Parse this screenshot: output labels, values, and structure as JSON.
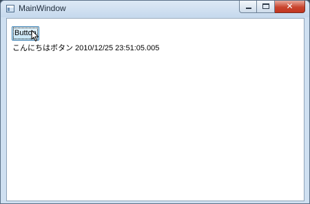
{
  "window": {
    "title": "MainWindow",
    "icon": "app-window-icon",
    "close_glyph": "✕"
  },
  "content": {
    "button_label": "Button",
    "status_text": "こんにちはボタン 2010/12/25 23:51:05.005"
  },
  "icons": {
    "cursor": "arrow-cursor-icon"
  },
  "colors": {
    "titlebar": "#c6d9ed",
    "close_button": "#c9452f",
    "button_border": "#3c7fb1"
  }
}
